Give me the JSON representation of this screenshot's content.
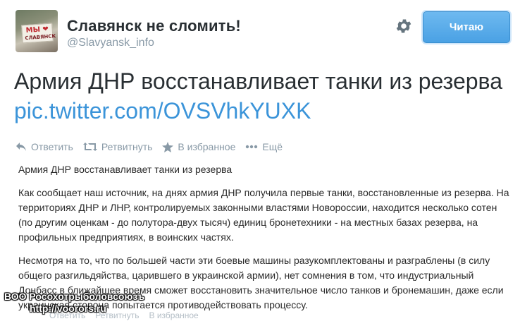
{
  "profile": {
    "display_name": "Славянск не сломить!",
    "screen_name": "@Slavyansk_info",
    "avatar_text_line1": "МЫ ❤",
    "avatar_text_line2": "СЛАВЯНСК"
  },
  "follow_button": {
    "label": "Читаю"
  },
  "tweet": {
    "text": "Армия ДНР восстанавливает танки из резерва ",
    "link": "pic.twitter.com/OVSVhkYUXK"
  },
  "actions": [
    {
      "icon": "reply-icon",
      "label": "Ответить"
    },
    {
      "icon": "retweet-icon",
      "label": "Ретвитнуть"
    },
    {
      "icon": "star-icon",
      "label": "В избранное"
    },
    {
      "icon": "more-icon",
      "label": "Ещё"
    }
  ],
  "card": {
    "title": "Армия ДНР восстанавливает танки из резерва",
    "paragraph1": "Как сообщает наш источник, на днях армия ДНР получила первые танки, восстановленные из резерва. На территориях ДНР и ЛНР, контролируемых законными властями Новороссии, находится несколько сотен (по другим оценкам - до полутора-двух тысяч) единиц бронетехники - на местных базах резерва, на профильных предприятиях, в воинских частях.",
    "paragraph2": "Несмотря на то, что по большей части эти боевые машины разукомплектованы и разграблены (в силу общего разгильдяйства, царившего в украинской армии), нет сомнения в том, что индустриальный Донбасс в ближайшее время сможет восстановить значительное число танков и бронемашин, даже если украинская сторона попытается противодействовать процессу."
  },
  "watermark": {
    "line1": "ВОО Росохотрыболовсоюзъ",
    "line2": "http://voorors.ru"
  },
  "repeat_actions": [
    "Ответить",
    "Ретвитнуть",
    "В избранное"
  ]
}
